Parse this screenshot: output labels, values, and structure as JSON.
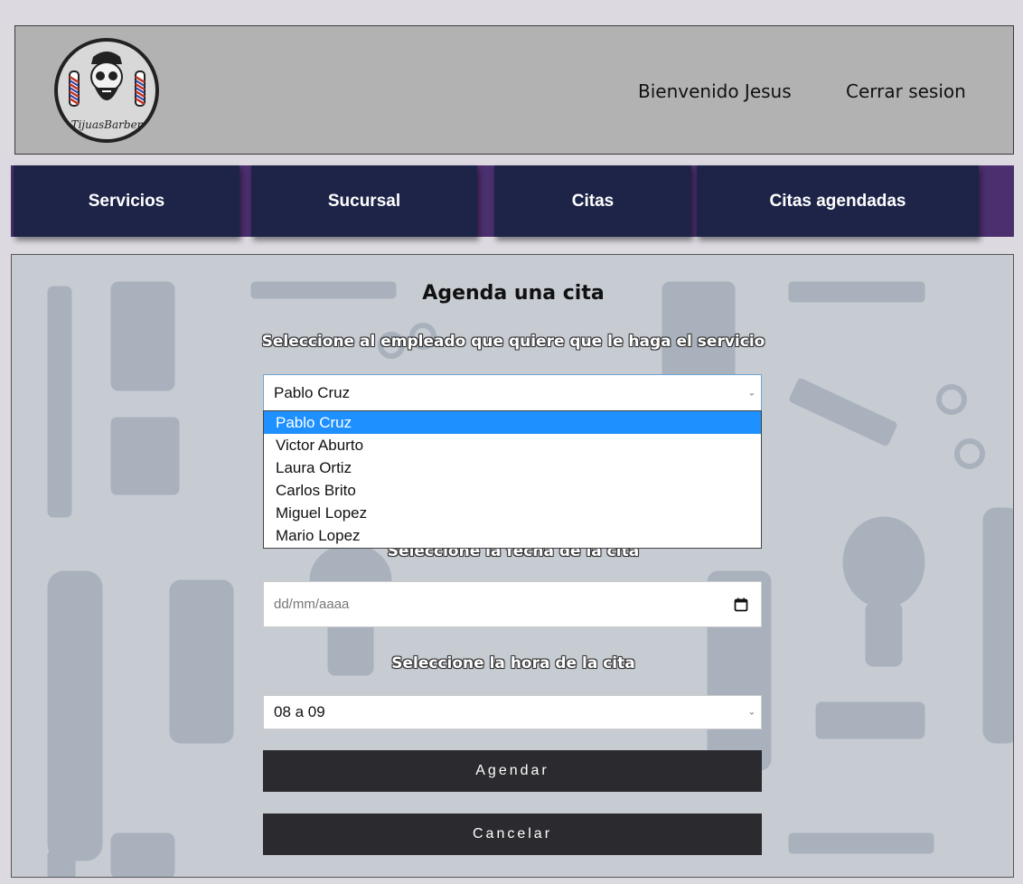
{
  "header": {
    "logo_text": "TijuasBarber",
    "welcome": "Bienvenido Jesus",
    "logout": "Cerrar sesion"
  },
  "nav": {
    "items": [
      {
        "label": "Servicios"
      },
      {
        "label": "Sucursal"
      },
      {
        "label": "Citas"
      },
      {
        "label": "Citas agendadas"
      }
    ]
  },
  "form": {
    "title": "Agenda una cita",
    "employee_label": "Seleccione al empleado que quiere que le haga el servicio",
    "employee_selected": "Pablo Cruz",
    "employee_options": [
      "Pablo Cruz",
      "Victor Aburto",
      "Laura Ortiz",
      "Carlos Brito",
      "Miguel Lopez",
      "Mario Lopez"
    ],
    "date_label": "Seleccione la fecha de la cita",
    "date_placeholder": "dd/mm/aaaa",
    "time_label": "Seleccione la hora de la cita",
    "time_selected": "08 a 09",
    "submit_label": "Agendar",
    "cancel_label": "Cancelar"
  },
  "icons": {
    "calendar": "calendar-icon",
    "chevron": "chevron-down-icon",
    "logo": "barber-skull-logo"
  },
  "colors": {
    "nav_bg": "#1d2448",
    "nav_strip": "#4b2f6e",
    "highlight": "#1e90ff",
    "button_bg": "#2a2a2f",
    "header_bg": "#b2b2b2"
  }
}
